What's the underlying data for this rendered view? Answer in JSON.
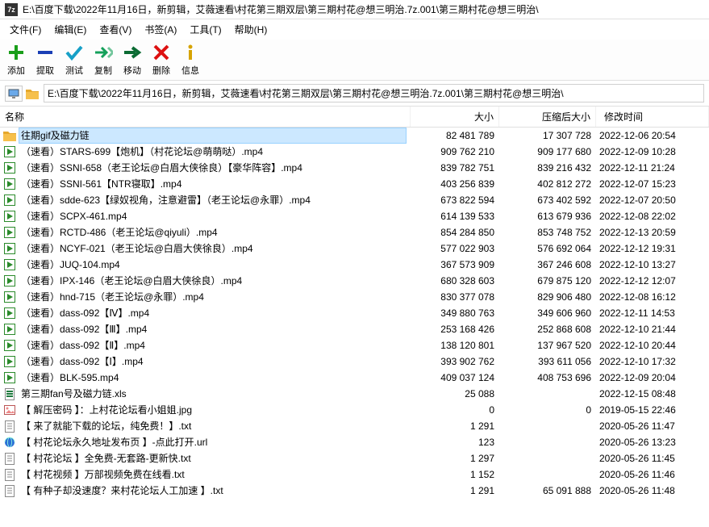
{
  "window": {
    "title": "E:\\百度下载\\2022年11月16日，新剪辑，艾薇速看\\村花第三期双层\\第三期村花@想三明治.7z.001\\第三期村花@想三明治\\"
  },
  "menu": {
    "file": "文件(F)",
    "edit": "编辑(E)",
    "view": "查看(V)",
    "bookmarks": "书签(A)",
    "tools": "工具(T)",
    "help": "帮助(H)"
  },
  "toolbar": {
    "add": "添加",
    "extract": "提取",
    "test": "测试",
    "copy": "复制",
    "move": "移动",
    "delete": "删除",
    "info": "信息"
  },
  "path": "E:\\百度下载\\2022年11月16日，新剪辑，艾薇速看\\村花第三期双层\\第三期村花@想三明治.7z.001\\第三期村花@想三明治\\",
  "columns": {
    "name": "名称",
    "size": "大小",
    "packed": "压缩后大小",
    "mtime": "修改时间"
  },
  "rows": [
    {
      "icon": "folder",
      "name": "往期gif及磁力链",
      "size": "82 481 789",
      "packed": "17 307 728",
      "mtime": "2022-12-06 20:54",
      "sel": true
    },
    {
      "icon": "video",
      "name": "（速看）STARS-699【炮机】（村花论坛@萌萌哒）.mp4",
      "size": "909 762 210",
      "packed": "909 177 680",
      "mtime": "2022-12-09 10:28"
    },
    {
      "icon": "video",
      "name": "（速看）SSNI-658（老王论坛@白眉大侠徐良）【豪华阵容】.mp4",
      "size": "839 782 751",
      "packed": "839 216 432",
      "mtime": "2022-12-11 21:24"
    },
    {
      "icon": "video",
      "name": "（速看）SSNI-561【NTR寝取】.mp4",
      "size": "403 256 839",
      "packed": "402 812 272",
      "mtime": "2022-12-07 15:23"
    },
    {
      "icon": "video",
      "name": "（速看）sdde-623【绿奴视角，注意避雷】（老王论坛@永罪）.mp4",
      "size": "673 822 594",
      "packed": "673 402 592",
      "mtime": "2022-12-07 20:50"
    },
    {
      "icon": "video",
      "name": "（速看）SCPX-461.mp4",
      "size": "614 139 533",
      "packed": "613 679 936",
      "mtime": "2022-12-08 22:02"
    },
    {
      "icon": "video",
      "name": "（速看）RCTD-486（老王论坛@qiyuli）.mp4",
      "size": "854 284 850",
      "packed": "853 748 752",
      "mtime": "2022-12-13 20:59"
    },
    {
      "icon": "video",
      "name": "（速看）NCYF-021（老王论坛@白眉大侠徐良）.mp4",
      "size": "577 022 903",
      "packed": "576 692 064",
      "mtime": "2022-12-12 19:31"
    },
    {
      "icon": "video",
      "name": "（速看）JUQ-104.mp4",
      "size": "367 573 909",
      "packed": "367 246 608",
      "mtime": "2022-12-10 13:27"
    },
    {
      "icon": "video",
      "name": "（速看）IPX-146（老王论坛@白眉大侠徐良）.mp4",
      "size": "680 328 603",
      "packed": "679 875 120",
      "mtime": "2022-12-12 12:07"
    },
    {
      "icon": "video",
      "name": "（速看）hnd-715（老王论坛@永罪）.mp4",
      "size": "830 377 078",
      "packed": "829 906 480",
      "mtime": "2022-12-08 16:12"
    },
    {
      "icon": "video",
      "name": "（速看）dass-092【Ⅳ】.mp4",
      "size": "349 880 763",
      "packed": "349 606 960",
      "mtime": "2022-12-11 14:53"
    },
    {
      "icon": "video",
      "name": "（速看）dass-092【Ⅲ】.mp4",
      "size": "253 168 426",
      "packed": "252 868 608",
      "mtime": "2022-12-10 21:44"
    },
    {
      "icon": "video",
      "name": "（速看）dass-092【Ⅱ】.mp4",
      "size": "138 120 801",
      "packed": "137 967 520",
      "mtime": "2022-12-10 20:44"
    },
    {
      "icon": "video",
      "name": "（速看）dass-092【Ⅰ】.mp4",
      "size": "393 902 762",
      "packed": "393 611 056",
      "mtime": "2022-12-10 17:32"
    },
    {
      "icon": "video",
      "name": "（速看）BLK-595.mp4",
      "size": "409 037 124",
      "packed": "408 753 696",
      "mtime": "2022-12-09 20:04"
    },
    {
      "icon": "xls",
      "name": "第三期fan号及磁力链.xls",
      "size": "25 088",
      "packed": "",
      "mtime": "2022-12-15 08:48"
    },
    {
      "icon": "img",
      "name": "【 解压密码 】：上村花论坛看小姐姐.jpg",
      "size": "0",
      "packed": "0",
      "mtime": "2019-05-15 22:46"
    },
    {
      "icon": "txt",
      "name": "【 来了就能下载的论坛，纯免费！】.txt",
      "size": "1 291",
      "packed": "",
      "mtime": "2020-05-26 11:47"
    },
    {
      "icon": "url",
      "name": "【 村花论坛永久地址发布页 】-点此打开.url",
      "size": "123",
      "packed": "",
      "mtime": "2020-05-26 13:23"
    },
    {
      "icon": "txt",
      "name": "【 村花论坛 】全免费-无套路-更新快.txt",
      "size": "1 297",
      "packed": "",
      "mtime": "2020-05-26 11:45"
    },
    {
      "icon": "txt",
      "name": "【 村花视频 】万部视频免费在线看.txt",
      "size": "1 152",
      "packed": "",
      "mtime": "2020-05-26 11:46"
    },
    {
      "icon": "txt",
      "name": "【 有种子却没速度？来村花论坛人工加速 】.txt",
      "size": "1 291",
      "packed": "65 091 888",
      "mtime": "2020-05-26 11:48"
    }
  ]
}
